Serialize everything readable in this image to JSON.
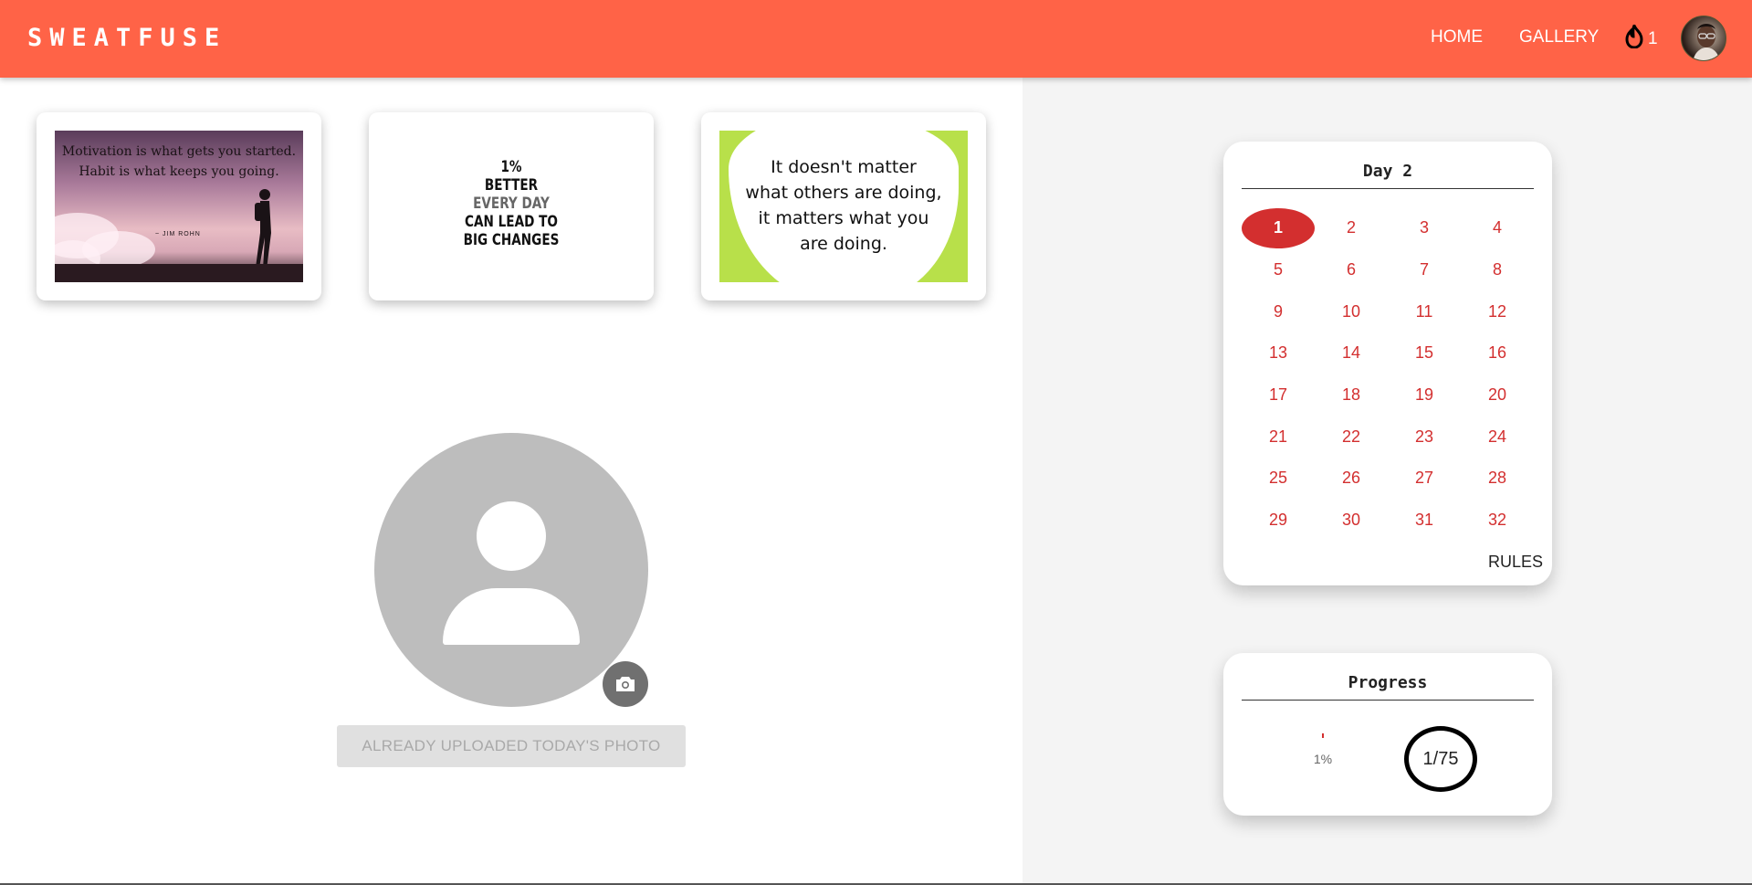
{
  "header": {
    "brand": "SWEATFUSE",
    "nav": {
      "home": "HOME",
      "gallery": "GALLERY"
    },
    "streak_count": "1",
    "streak_icon": "fire-icon",
    "accent_color": "#ff6347"
  },
  "quotes": [
    {
      "lines": [
        "Motivation is what gets you started.",
        "Habit is what keeps you going."
      ],
      "author": "~ JIM ROHN"
    },
    {
      "lines": [
        "1%",
        "BETTER",
        "EVERY DAY",
        "CAN LEAD TO",
        "BIG CHANGES"
      ]
    },
    {
      "lines": [
        "It doesn't matter",
        "what others are doing,",
        "it matters what you",
        "are doing."
      ]
    }
  ],
  "upload": {
    "button_label": "ALREADY UPLOADED TODAY'S PHOTO",
    "camera_icon": "camera-icon"
  },
  "calendar": {
    "title": "Day 2",
    "active_day": 1,
    "days": [
      "1",
      "2",
      "3",
      "4",
      "5",
      "6",
      "7",
      "8",
      "9",
      "10",
      "11",
      "12",
      "13",
      "14",
      "15",
      "16",
      "17",
      "18",
      "19",
      "20",
      "21",
      "22",
      "23",
      "24",
      "25",
      "26",
      "27",
      "28",
      "29",
      "30",
      "31",
      "32"
    ],
    "rules_label": "RULES",
    "day_color": "#d32f2f"
  },
  "progress": {
    "title": "Progress",
    "percent_label": "1%",
    "percent": 1,
    "count_label": "1/75"
  }
}
